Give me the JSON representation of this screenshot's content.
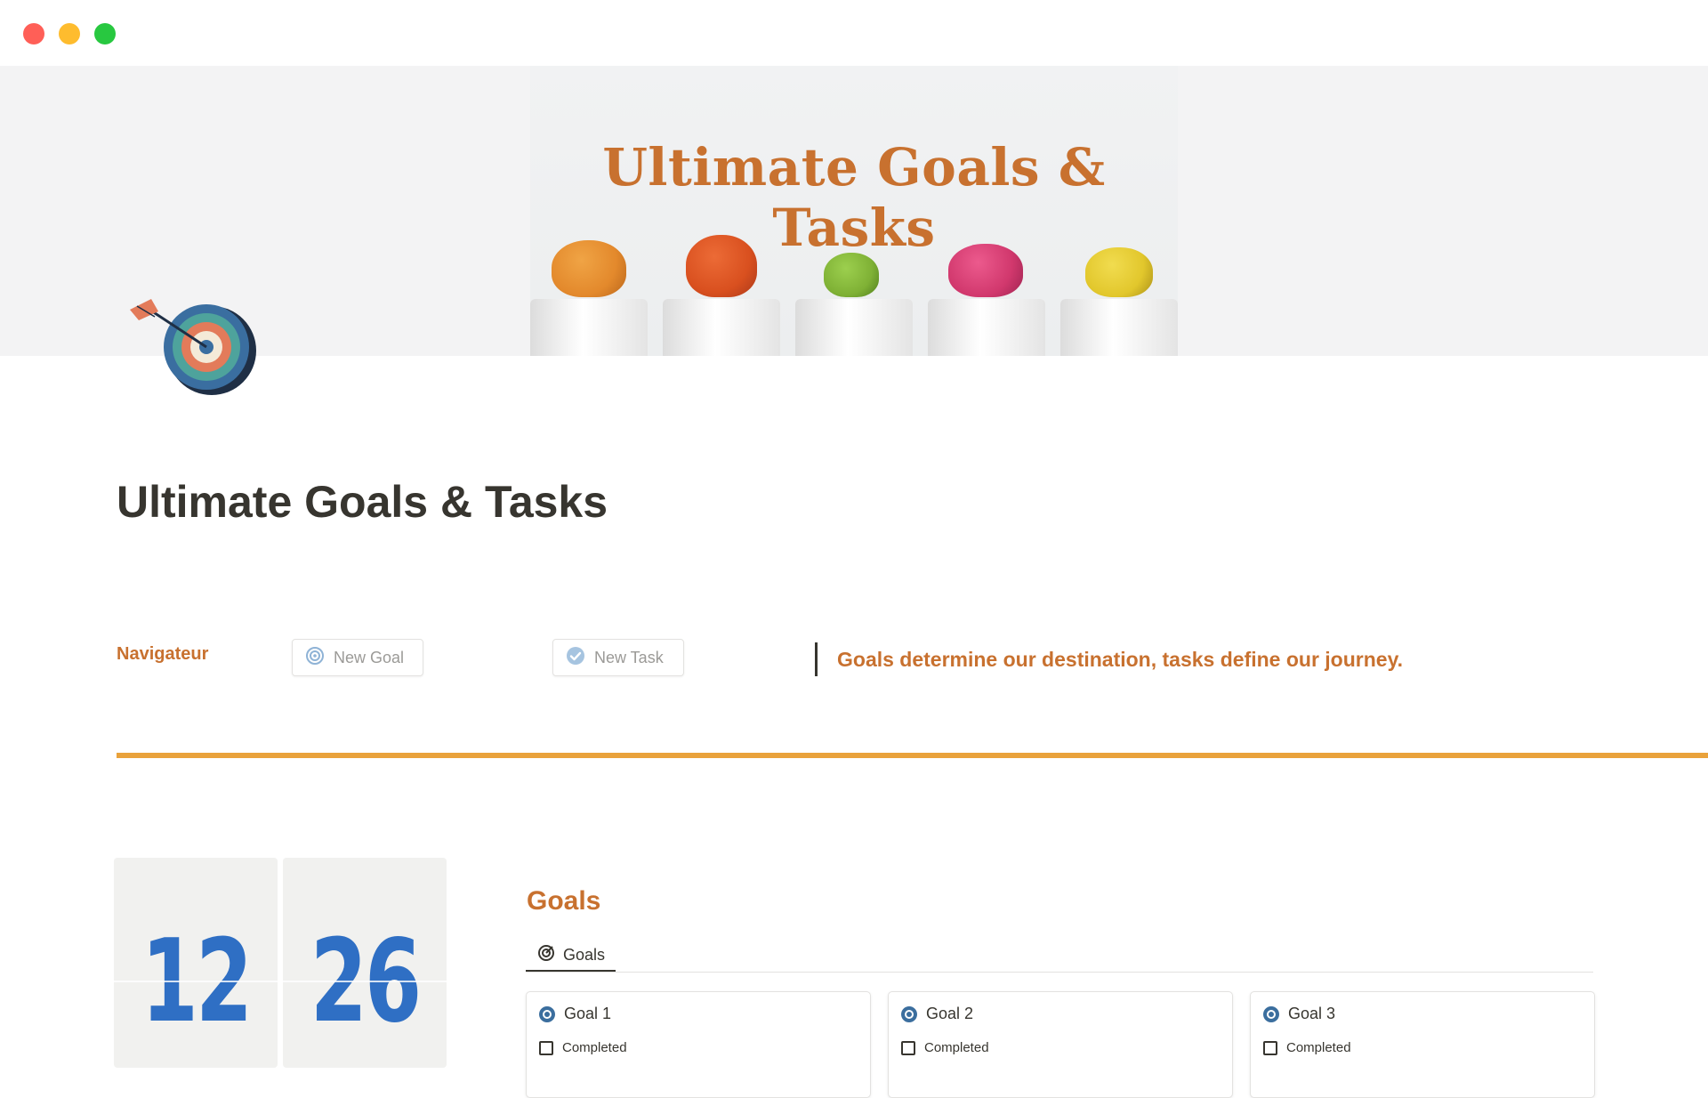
{
  "window": {
    "controls": [
      "close",
      "minimize",
      "maximize"
    ]
  },
  "cover": {
    "title": "Ultimate Goals & Tasks",
    "cactus_colors": [
      "#e3892c",
      "#d9501f",
      "#7fb135",
      "#d1386d",
      "#e2c72c"
    ]
  },
  "page": {
    "icon": "target-arrow-icon",
    "title": "Ultimate Goals & Tasks"
  },
  "navigator": {
    "label": "Navigateur",
    "new_goal_label": "New Goal",
    "new_task_label": "New Task"
  },
  "quote": {
    "text": "Goals determine our destination, tasks define our journey."
  },
  "counters": {
    "first": "12",
    "second": "26"
  },
  "goals": {
    "heading": "Goals",
    "tab_label": "Goals",
    "cards": [
      {
        "title": "Goal 1",
        "checkbox_label": "Completed"
      },
      {
        "title": "Goal 2",
        "checkbox_label": "Completed"
      },
      {
        "title": "Goal 3",
        "checkbox_label": "Completed"
      }
    ]
  },
  "colors": {
    "accent": "#c8712f",
    "divider": "#e9a23b",
    "counter_number": "#2f6fc4",
    "goal_icon": "#3b6e9e"
  }
}
